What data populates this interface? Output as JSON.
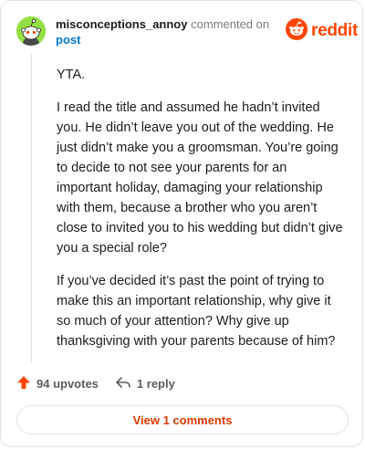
{
  "header": {
    "username": "misconceptions_annoy",
    "action_text": "commented on",
    "post_link": "post"
  },
  "logo": {
    "icon": "reddit-snoo-icon",
    "wordmark": "reddit",
    "color": "#ff4500"
  },
  "avatar": {
    "icon": "snoo-avatar-icon",
    "background": "#94e044"
  },
  "comment": {
    "paragraphs": [
      "YTA.",
      "I read the title and assumed he hadn’t invited you. He didn’t leave you out of the wedding. He just didn’t make you a groomsman. You’re going to decide to not see your parents for an important holiday, damaging your relationship with them, because a brother who you aren’t close to invited you to his wedding but didn’t give you a special role?",
      "If you’ve decided it’s past the point of trying to make this an important relationship, why give it so much of your attention? Why give up thanksgiving with your parents because of him?"
    ]
  },
  "actions": {
    "upvotes_label": "94 upvotes",
    "upvote_icon": "upvote-arrow-icon",
    "reply_label": "1 reply",
    "reply_icon": "reply-arrow-icon"
  },
  "view_button": {
    "label": "View 1 comments",
    "color": "#d93900"
  }
}
